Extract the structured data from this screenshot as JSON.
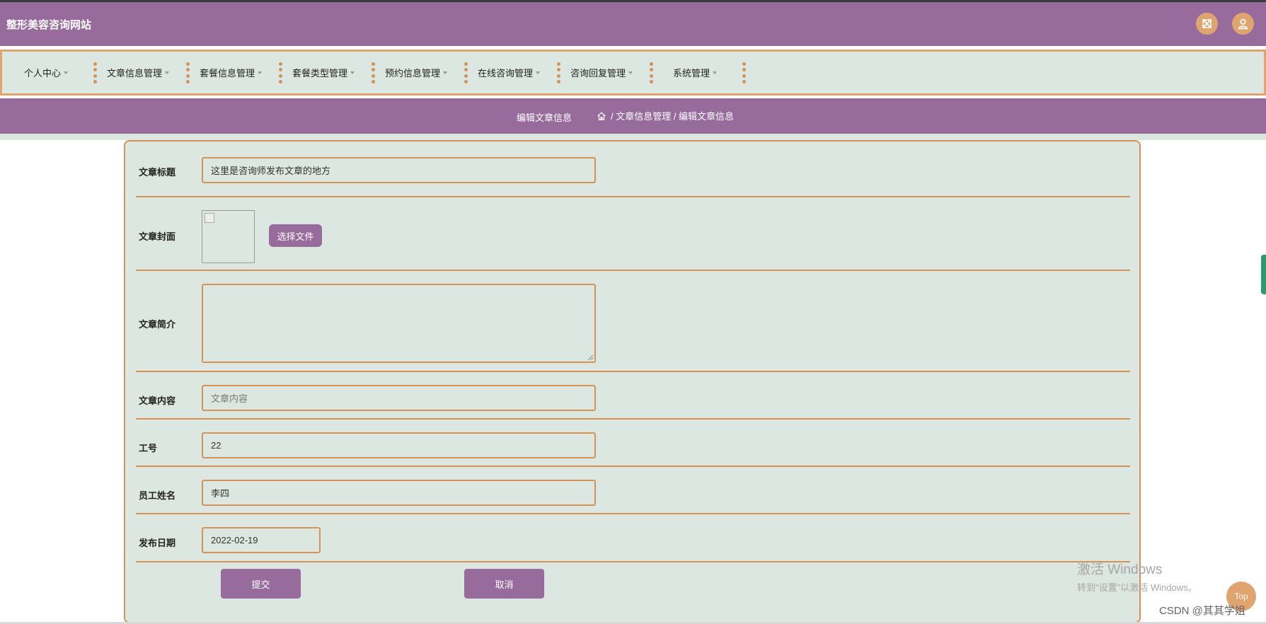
{
  "header": {
    "site_title": "整形美容咨询网站",
    "fullscreen_icon": "fullscreen-icon",
    "user_icon": "user-icon"
  },
  "nav": {
    "items": [
      {
        "label": "个人中心"
      },
      {
        "label": "文章信息管理"
      },
      {
        "label": "套餐信息管理"
      },
      {
        "label": "套餐类型管理"
      },
      {
        "label": "预约信息管理"
      },
      {
        "label": "在线咨询管理"
      },
      {
        "label": "咨询回复管理"
      },
      {
        "label": "系统管理"
      }
    ]
  },
  "breadcrumb": {
    "page_title": "编辑文章信息",
    "home_icon": "home-icon",
    "path": "/ 文章信息管理 / 编辑文章信息"
  },
  "form": {
    "title": {
      "label": "文章标题",
      "value": "这里是咨询师发布文章的地方"
    },
    "cover": {
      "label": "文章封面",
      "button": "选择文件"
    },
    "summary": {
      "label": "文章简介",
      "value": ""
    },
    "content": {
      "label": "文章内容",
      "placeholder": "文章内容"
    },
    "staff_id": {
      "label": "工号",
      "value": "22"
    },
    "staff_name": {
      "label": "员工姓名",
      "value": "李四"
    },
    "publish_date": {
      "label": "发布日期",
      "value": "2022-02-19"
    },
    "submit": "提交",
    "cancel": "取消"
  },
  "overlay": {
    "watermark_line1": "激活 Windows",
    "watermark_line2": "转到\"设置\"以激活 Windows。",
    "csdn": "CSDN @其其学姐",
    "top_button": "Top"
  },
  "colors": {
    "purple": "#976c9d",
    "orange": "#e0a46e",
    "panel": "#dde7e2"
  }
}
